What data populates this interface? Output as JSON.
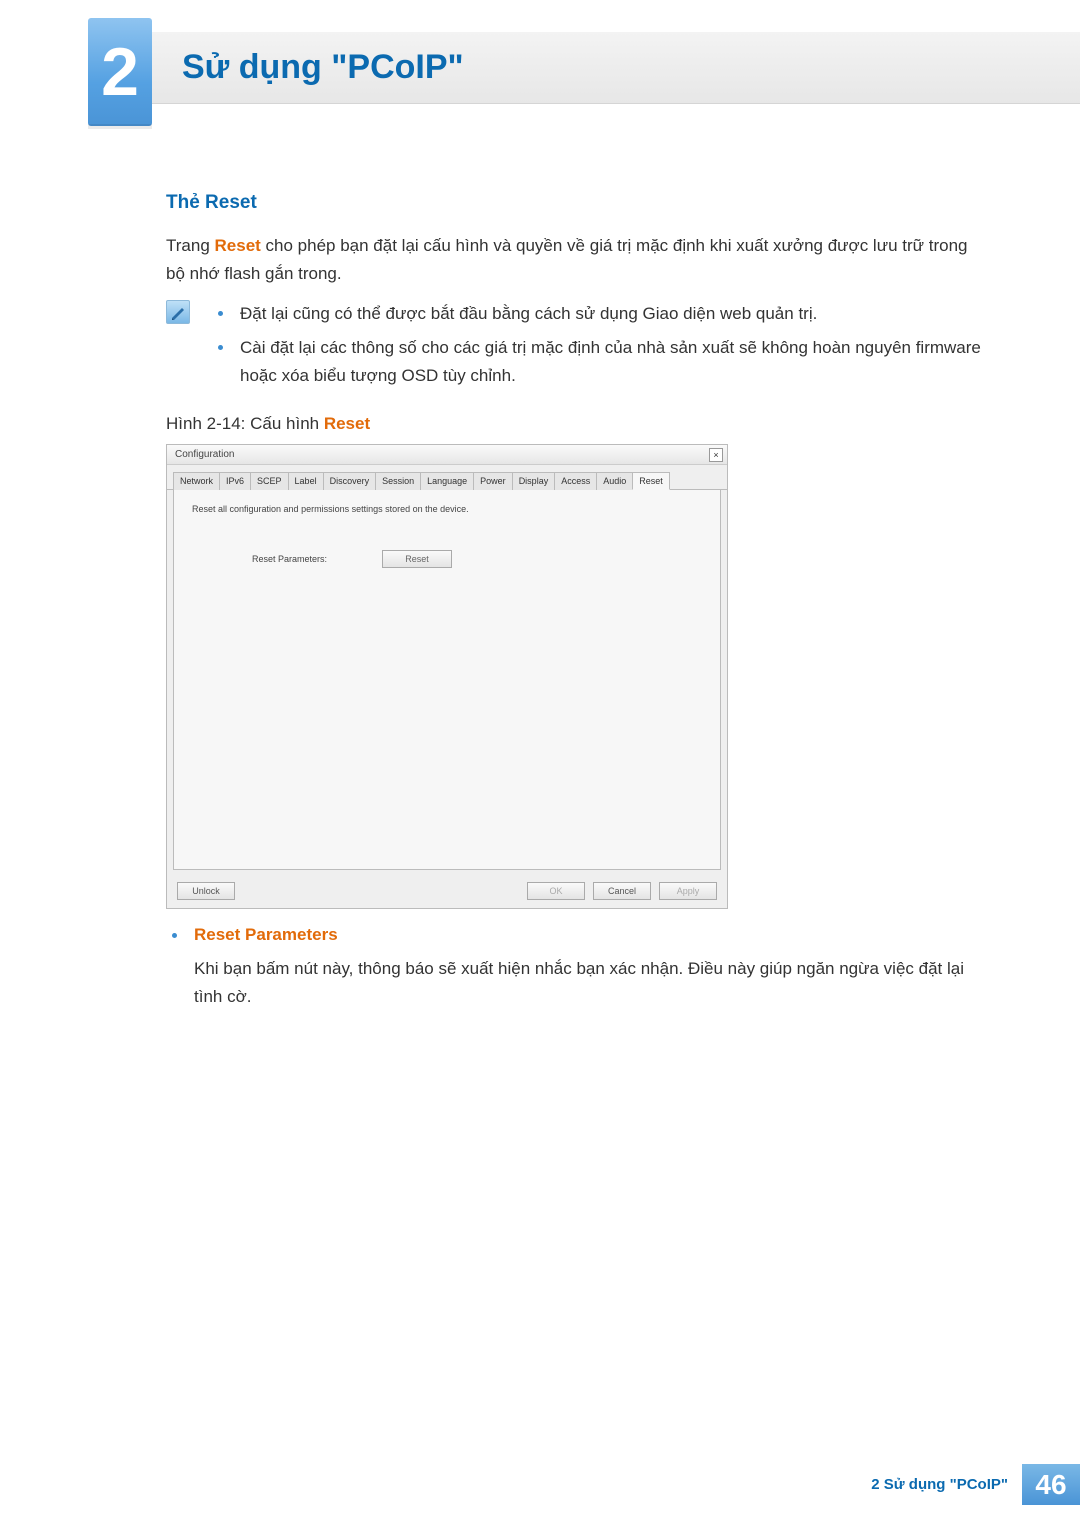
{
  "chapter": {
    "number": "2",
    "title": "Sử dụng \"PCoIP\""
  },
  "section": {
    "heading": "Thẻ Reset",
    "intro_pre": "Trang ",
    "intro_accent": "Reset",
    "intro_post": " cho phép bạn đặt lại cấu hình và quyền về giá trị mặc định khi xuất xưởng được lưu trữ trong bộ nhớ flash gắn trong."
  },
  "notes": [
    "Đặt lại cũng có thể được bắt đầu bằng cách sử dụng Giao diện web quản trị.",
    "Cài đặt lại các thông số cho các giá trị mặc định của nhà sản xuất sẽ không hoàn nguyên firmware hoặc xóa biểu tượng OSD tùy chỉnh."
  ],
  "figure": {
    "pre": "Hình 2-14: Cấu hình ",
    "accent": "Reset"
  },
  "config_window": {
    "title": "Configuration",
    "tabs": [
      "Network",
      "IPv6",
      "SCEP",
      "Label",
      "Discovery",
      "Session",
      "Language",
      "Power",
      "Display",
      "Access",
      "Audio",
      "Reset"
    ],
    "active_tab_index": 11,
    "description": "Reset all configuration and permissions settings stored on the device.",
    "param_label": "Reset Parameters:",
    "reset_btn": "Reset",
    "unlock_btn": "Unlock",
    "ok_btn": "OK",
    "cancel_btn": "Cancel",
    "apply_btn": "Apply"
  },
  "subsection": {
    "heading": "Reset Parameters",
    "text": "Khi bạn bấm nút này, thông báo sẽ xuất hiện nhắc bạn xác nhận. Điều này giúp ngăn ngừa việc đặt lại tình cờ."
  },
  "footer": {
    "text": "2 Sử dụng \"PCoIP\"",
    "page": "46"
  }
}
